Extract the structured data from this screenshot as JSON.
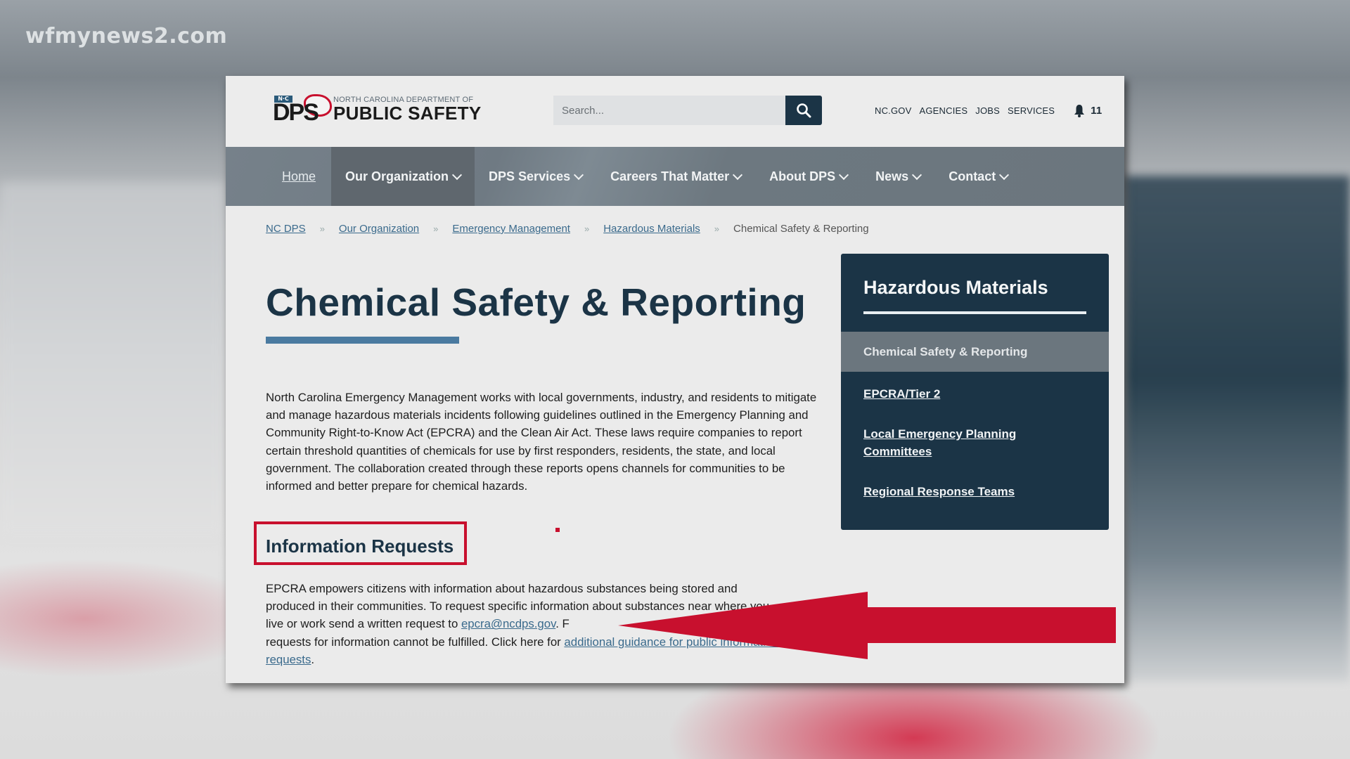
{
  "watermark": "wfmynews2.com",
  "header": {
    "logo": {
      "nc_label": "N·C",
      "dps_label": "DPS",
      "small_text": "NORTH CAROLINA DEPARTMENT OF",
      "big_text": "PUBLIC SAFETY"
    },
    "search": {
      "placeholder": "Search...",
      "value": "",
      "icon": "search-icon"
    },
    "utility_links": [
      "NC.GOV",
      "AGENCIES",
      "JOBS",
      "SERVICES"
    ],
    "notifications": {
      "icon": "bell-icon",
      "count": "11"
    }
  },
  "nav": {
    "items": [
      {
        "label": "Home",
        "dropdown": false
      },
      {
        "label": "Our Organization",
        "dropdown": true,
        "active": true
      },
      {
        "label": "DPS Services",
        "dropdown": true
      },
      {
        "label": "Careers That Matter",
        "dropdown": true
      },
      {
        "label": "About DPS",
        "dropdown": true
      },
      {
        "label": "News",
        "dropdown": true
      },
      {
        "label": "Contact",
        "dropdown": true
      }
    ]
  },
  "breadcrumb": {
    "separator": "»",
    "items": [
      "NC DPS",
      "Our Organization",
      "Emergency Management",
      "Hazardous Materials"
    ],
    "current": "Chemical Safety & Reporting"
  },
  "main": {
    "title": "Chemical Safety & Reporting",
    "intro": "North Carolina Emergency Management works with local governments, industry, and residents to mitigate and manage hazardous materials incidents following guidelines outlined in the Emergency Planning and Community Right-to-Know Act (EPCRA) and the Clean Air Act. These laws require companies to report certain threshold quantities of chemicals for use by first responders, residents, the state, and local government. The collaboration created through these reports opens channels for communities to be informed and better prepare for chemical hazards.",
    "info_requests": {
      "heading": "Information Requests",
      "text_1": "EPCRA empowers citizens with information about hazardous substances being stored and produced in their communities. To request specific information about substances near where you live or work send a written request to ",
      "email_link": "epcra@ncdps.gov",
      "text_2": ". F",
      "text_3": " requests for information cannot be fulfilled. Click here for ",
      "guidance_link": "additional guidance for public information requests",
      "text_4": "."
    }
  },
  "sidebar": {
    "title": "Hazardous Materials",
    "items": [
      {
        "label": "Chemical Safety & Reporting",
        "active": true
      },
      {
        "label": "EPCRA/Tier 2"
      },
      {
        "label": "Local Emergency Planning Committees"
      },
      {
        "label": "Regional Response Teams"
      }
    ]
  },
  "annotation": {
    "arrow_color": "#c8102e",
    "box_color": "#c8102e"
  }
}
